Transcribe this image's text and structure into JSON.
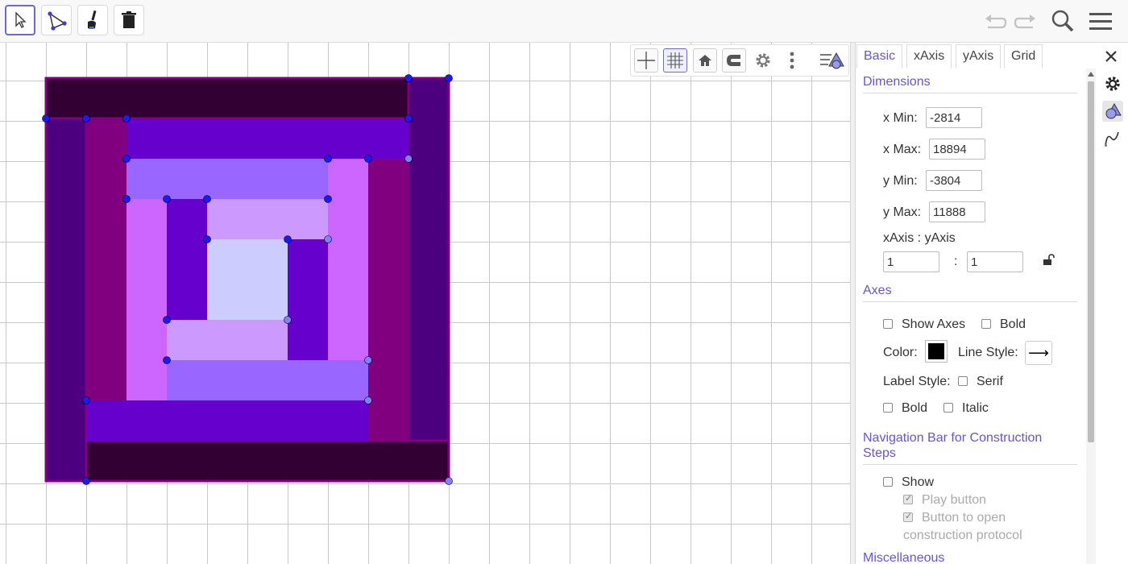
{
  "toolbar": {
    "tools": [
      {
        "name": "move-tool",
        "icon": "cursor-arrow-icon"
      },
      {
        "name": "polygon-tool",
        "icon": "polygon-icon"
      },
      {
        "name": "graphics-style-tool",
        "icon": "paintbrush-icon"
      },
      {
        "name": "delete-tool",
        "icon": "trash-icon"
      }
    ],
    "right": [
      "undo-icon",
      "redo-icon",
      "search-icon",
      "menu-icon"
    ]
  },
  "style_bar": [
    "axes-toggle-icon",
    "grid-toggle-icon",
    "home-icon",
    "magnet-icon",
    "gear-icon",
    "more-vertical-icon",
    "algebra-toggle-icon"
  ],
  "settings": {
    "tabs": [
      "Basic",
      "xAxis",
      "yAxis",
      "Grid"
    ],
    "active_tab": "Basic",
    "dimensions": {
      "title": "Dimensions",
      "xmin_label": "x Min:",
      "xmin": "-2814",
      "xmax_label": "x Max:",
      "xmax": "18894",
      "ymin_label": "y Min:",
      "ymin": "-3804",
      "ymax_label": "y Max:",
      "ymax": "11888",
      "ratio_label": "xAxis : yAxis",
      "ratio_x": "1",
      "ratio_sep": ":",
      "ratio_y": "1"
    },
    "axes": {
      "title": "Axes",
      "show_axes": "Show Axes",
      "bold": "Bold",
      "color_label": "Color:",
      "color": "#000000",
      "line_style_label": "Line Style:",
      "line_style_arrow": "⟶",
      "label_style": "Label Style:",
      "serif": "Serif",
      "bold2": "Bold",
      "italic": "Italic"
    },
    "nav": {
      "title_line1": "Navigation Bar for Construction",
      "title_line2": "Steps",
      "show": "Show",
      "play_button": "Play button",
      "protocol_line1": "Button to open",
      "protocol_line2": "construction protocol"
    },
    "misc_title": "Miscellaneous"
  },
  "colors": {
    "accent": "#6557d2",
    "dark": "#330033",
    "violet": "#4c0080",
    "magenta": "#800080",
    "indigo": "#6600cc",
    "lavender": "#9966ff",
    "orchid": "#cc66ff",
    "lilac": "#cc99ff",
    "pale": "#ccccff",
    "point": "#1a1aff",
    "point_free": "#8080ff"
  }
}
